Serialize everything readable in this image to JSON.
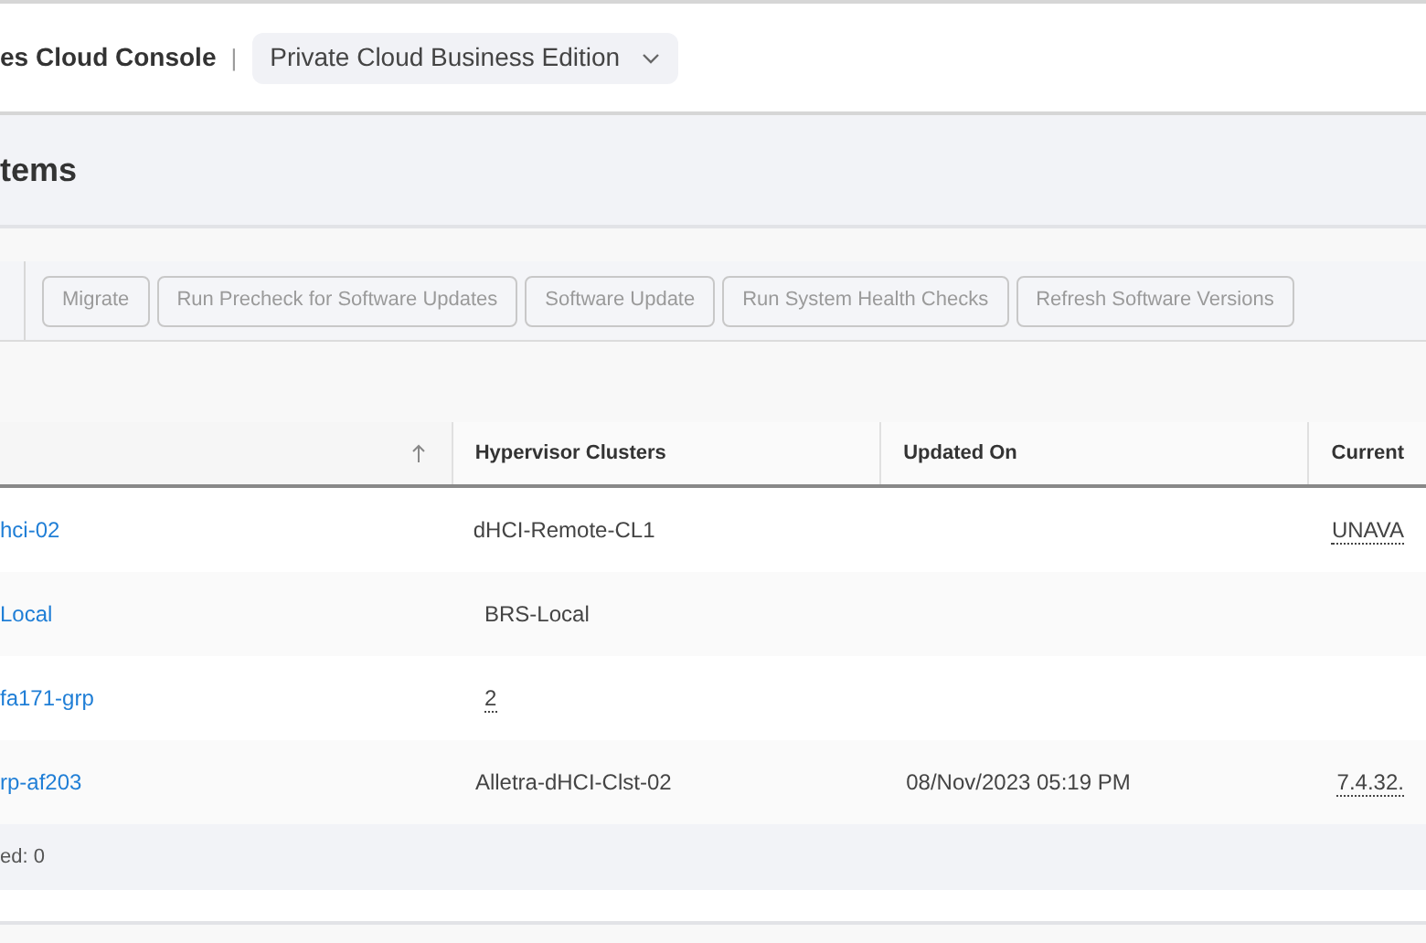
{
  "header": {
    "app_title": "es Cloud Console",
    "separator": "|",
    "edition_select": "Private Cloud Business Edition"
  },
  "page_title": "tems",
  "toolbar": {
    "buttons": [
      {
        "label": "Migrate",
        "disabled": true
      },
      {
        "label": "Run Precheck for Software Updates",
        "disabled": true
      },
      {
        "label": "Software Update",
        "disabled": true
      },
      {
        "label": "Run System Health Checks",
        "disabled": true
      },
      {
        "label": "Refresh Software Versions",
        "disabled": true
      }
    ]
  },
  "table": {
    "columns": [
      {
        "sorted": true
      },
      {
        "label": "Hypervisor Clusters",
        "sorted": false
      },
      {
        "label": "Updated On",
        "sorted": false
      },
      {
        "label": "Current",
        "sorted": false
      }
    ],
    "rows": [
      {
        "cells": [
          {
            "kind": "link",
            "text": "hci-02"
          },
          {
            "kind": "text",
            "text": "dHCI-Remote-CL1"
          },
          {
            "kind": "empty"
          },
          {
            "kind": "dotted",
            "text": "UNAVA"
          }
        ]
      },
      {
        "cells": [
          {
            "kind": "link",
            "text": "Local"
          },
          {
            "kind": "text",
            "text": "BRS-Local"
          },
          {
            "kind": "empty"
          },
          {
            "kind": "empty"
          }
        ]
      },
      {
        "cells": [
          {
            "kind": "link",
            "text": "fa171-grp"
          },
          {
            "kind": "dotted",
            "text": "2"
          },
          {
            "kind": "empty"
          },
          {
            "kind": "empty"
          }
        ]
      },
      {
        "cells": [
          {
            "kind": "link",
            "text": "rp-af203"
          },
          {
            "kind": "text",
            "text": "Alletra-dHCI-Clst-02"
          },
          {
            "kind": "text",
            "text": "08/Nov/2023 05:19 PM"
          },
          {
            "kind": "dotted",
            "text": "7.4.32."
          }
        ]
      }
    ],
    "footer": "ed: 0"
  }
}
